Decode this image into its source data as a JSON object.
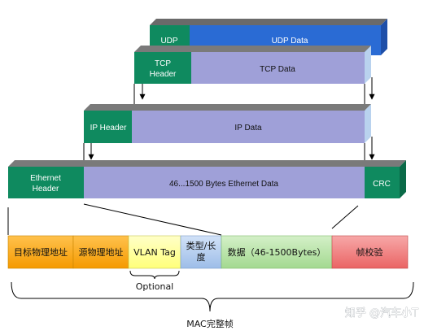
{
  "layers": {
    "udp": {
      "header": "UDP",
      "data": "UDP Data"
    },
    "tcp": {
      "header_line1": "TCP",
      "header_line2": "Header",
      "data": "TCP Data"
    },
    "ip": {
      "header": "IP Header",
      "data": "IP Data"
    },
    "ethernet": {
      "header_line1": "Ethernet",
      "header_line2": "Header",
      "data": "46...1500 Bytes Ethernet Data",
      "crc": "CRC"
    }
  },
  "frame_fields": [
    {
      "label": "目标物理地址",
      "color": "#ffaa1f"
    },
    {
      "label": "源物理地址",
      "color": "#ffaa1f"
    },
    {
      "label": "VLAN Tag",
      "color": "#ffff99"
    },
    {
      "label_line1": "类型/长",
      "label_line2": "度",
      "color": "#b3cdf0"
    },
    {
      "label": "数据（46-1500Bytes）",
      "color": "#b8e4a8"
    },
    {
      "label": "帧校验",
      "color": "#f07d7d"
    }
  ],
  "optional_label": "Optional",
  "frame_caption": "MAC完整帧",
  "watermark": "知乎 @汽车小T",
  "colors": {
    "header_green": "#0f8a5f",
    "udp_blue": "#2a6bd4",
    "data_purple": "#9fa0d8",
    "bar_top": "#7f7f7f"
  }
}
